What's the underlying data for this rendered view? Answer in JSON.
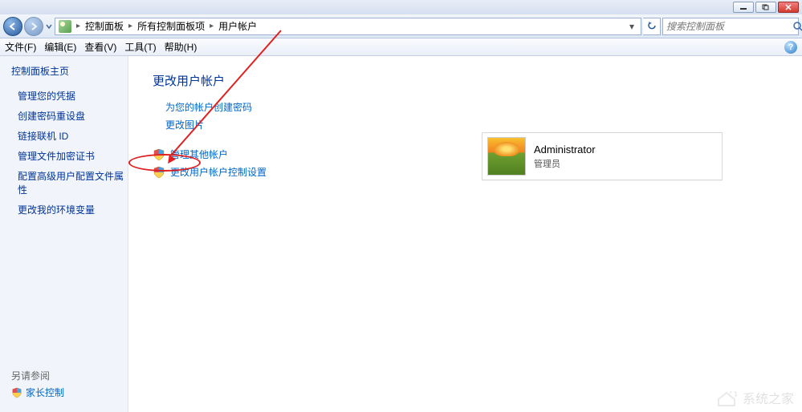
{
  "breadcrumbs": [
    "控制面板",
    "所有控制面板项",
    "用户帐户"
  ],
  "search_placeholder": "搜索控制面板",
  "menubar": [
    "文件(F)",
    "编辑(E)",
    "查看(V)",
    "工具(T)",
    "帮助(H)"
  ],
  "sidebar": {
    "home": "控制面板主页",
    "items": [
      "管理您的凭据",
      "创建密码重设盘",
      "链接联机 ID",
      "管理文件加密证书",
      "配置高级用户配置文件属性",
      "更改我的环境变量"
    ],
    "see_also": "另请参阅",
    "parental": "家长控制"
  },
  "content": {
    "heading": "更改用户帐户",
    "top_links": [
      "为您的帐户创建密码",
      "更改图片"
    ],
    "shield_links": [
      "管理其他帐户",
      "更改用户帐户控制设置"
    ]
  },
  "account": {
    "name": "Administrator",
    "role": "管理员"
  },
  "watermark_text": "系统之家"
}
